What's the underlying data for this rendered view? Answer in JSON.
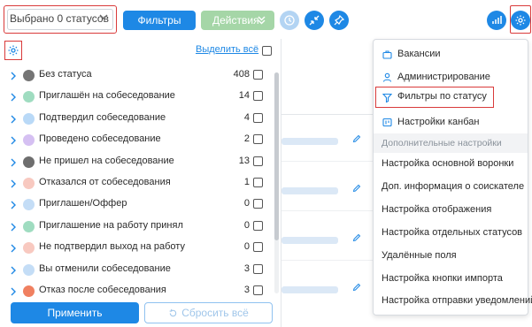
{
  "toolbar": {
    "status_select": "Выбрано 0 статусов",
    "filters_label": "Фильтры",
    "actions_label": "Действия"
  },
  "panel": {
    "select_all": "Выделить всё",
    "apply_label": "Применить",
    "reset_label": "Сбросить всё",
    "statuses": [
      {
        "name": "Без статуса",
        "count": "408",
        "color": "#757575"
      },
      {
        "name": "Приглашён на собеседование",
        "count": "14",
        "color": "#9fdcc0"
      },
      {
        "name": "Подтвердил собеседование",
        "count": "4",
        "color": "#b9d9f7"
      },
      {
        "name": "Проведено собеседование",
        "count": "2",
        "color": "#d5c0f2"
      },
      {
        "name": "Не пришел на собеседование",
        "count": "13",
        "color": "#6e6e6e"
      },
      {
        "name": "Отказался от собеседования",
        "count": "1",
        "color": "#f8c9c0"
      },
      {
        "name": "Приглашен/Оффер",
        "count": "0",
        "color": "#c4ddf6"
      },
      {
        "name": "Приглашение на работу принял",
        "count": "0",
        "color": "#9fdcc0"
      },
      {
        "name": "Не подтвердил выход на работу",
        "count": "0",
        "color": "#f8c9c0"
      },
      {
        "name": "Вы отменили собеседование",
        "count": "3",
        "color": "#c4ddf6"
      },
      {
        "name": "Отказ после собеседования",
        "count": "3",
        "color": "#f08060"
      }
    ]
  },
  "menu": {
    "items": [
      {
        "label": "Вакансии",
        "icon": "briefcase-icon"
      },
      {
        "label": "Администрирование",
        "icon": "user-icon"
      },
      {
        "label": "Фильтры по статусу",
        "icon": "filter-icon"
      },
      {
        "label": "Настройки канбан",
        "icon": "kanban-icon"
      }
    ],
    "section_label": "Дополнительные настройки",
    "extra": [
      "Настройка основной воронки",
      "Доп. информация о соискателе",
      "Настройка отображения",
      "Настройка отдельных статусов",
      "Удалённые поля",
      "Настройка кнопки импорта",
      "Настройка отправки уведомлений"
    ]
  },
  "colors": {
    "primary": "#1e88e5",
    "actions_green": "#a5d6a7",
    "highlight_red": "#d93a3a"
  }
}
